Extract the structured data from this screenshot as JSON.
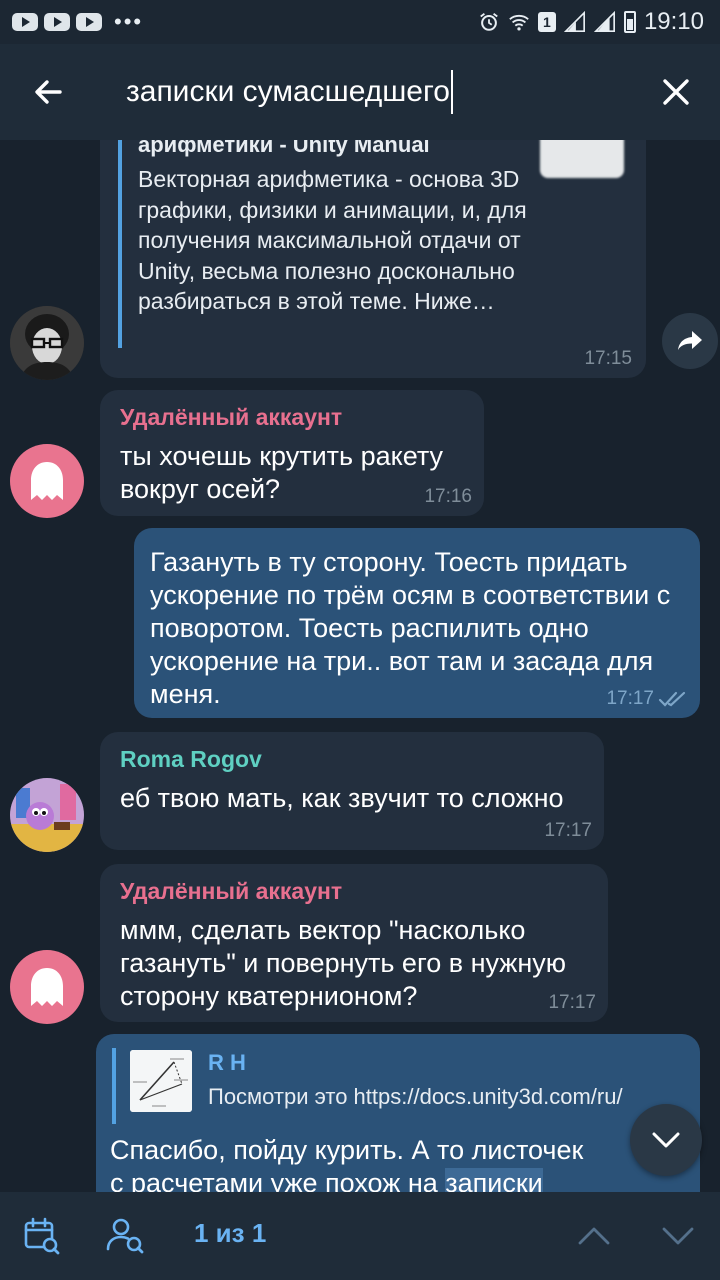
{
  "status_bar": {
    "time": "19:10",
    "sim_badge": "1",
    "more": "•••"
  },
  "search": {
    "query": "записки сумасшедшего"
  },
  "messages": [
    {
      "link_title": "арифметики - Unity Manual",
      "link_desc": "Векторная арифметика - основа 3D графики, физики и анимации, и, для получения максимальной отдачи от Unity, весьма полезно досконально разбираться в этой теме. Ниже…",
      "time": "17:15"
    },
    {
      "sender": "Удалённый аккаунт",
      "text": "ты хочешь крутить ракету вокруг осей?",
      "time": "17:16"
    },
    {
      "text": "Газануть в ту сторону. Тоесть придать ускорение по трём осям в соответствии с поворотом. Тоесть распилить одно ускорение на три.. вот там и засада для меня.",
      "time": "17:17"
    },
    {
      "sender": "Roma Rogov",
      "text": "еб твою мать, как звучит то сложно",
      "time": "17:17"
    },
    {
      "sender": "Удалённый аккаунт",
      "text": "ммм, сделать вектор \"насколько газануть\" и повернуть его в нужную сторону кватернионом?",
      "time": "17:17"
    },
    {
      "reply_name": "R H",
      "reply_text": "Посмотри это https://docs.unity3d.com/ru/",
      "text_line1": "Спасибо, пойду курить.  А то листочек",
      "text_line2_a": "с расчетами уже похож на ",
      "text_line2_b": "записки"
    }
  ],
  "bottom_bar": {
    "counter": "1 из 1"
  },
  "colors": {
    "background": "#18222d",
    "bar": "#1f2c39",
    "incoming_bubble": "#232f3e",
    "outgoing_bubble": "#2b5278",
    "accent": "#6ab3f3",
    "deleted_name": "#e8708f",
    "roma_name": "#5fd0c2"
  }
}
